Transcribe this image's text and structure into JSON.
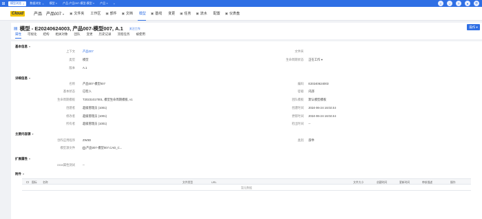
{
  "topbar": {
    "tabs": [
      {
        "label": "模型浏览",
        "active": true
      },
      {
        "label": "数据浏览",
        "active": false
      },
      {
        "label": "模型 ×",
        "active": false
      },
      {
        "label": "产品-产品007-模型-模型 ×",
        "active": false
      },
      {
        "label": "产品 ×",
        "active": false
      },
      {
        "label": "+",
        "active": false
      }
    ],
    "right_icons": [
      "search-icon",
      "bell-icon",
      "help-icon",
      "user-icon",
      "settings-icon"
    ]
  },
  "header": {
    "logo_text": "Cloud",
    "context_label": "产品",
    "context_value": "产品007",
    "nav": [
      {
        "icon": "▣",
        "label": "文件夹",
        "active": false
      },
      {
        "icon": "",
        "label": "工作区",
        "active": false
      },
      {
        "icon": "▣",
        "label": "部件",
        "active": false
      },
      {
        "icon": "▣",
        "label": "文档",
        "active": false
      },
      {
        "icon": "",
        "label": "模型",
        "active": true
      },
      {
        "icon": "▣",
        "label": "基线",
        "active": false
      },
      {
        "icon": "",
        "label": "变更",
        "active": false
      },
      {
        "icon": "▣",
        "label": "任务",
        "active": false
      },
      {
        "icon": "▣",
        "label": "流水",
        "active": false
      },
      {
        "icon": "",
        "label": "配置",
        "active": false
      },
      {
        "icon": "▣",
        "label": "仪表盘",
        "active": false
      }
    ]
  },
  "title": {
    "text": "模型 - E20240624003, 产品007-模型007, A.1",
    "follow": "关注工作",
    "ops_button": "操作 ▾",
    "subtabs": [
      {
        "label": "属性",
        "active": true
      },
      {
        "label": "可视化",
        "active": false
      },
      {
        "label": "结构",
        "active": false
      },
      {
        "label": "相关对象",
        "active": false
      },
      {
        "label": "团队",
        "active": false
      },
      {
        "label": "变更",
        "active": false
      },
      {
        "label": "历史记录",
        "active": false
      },
      {
        "label": "流程任务",
        "active": false
      },
      {
        "label": "被使用",
        "active": false
      }
    ]
  },
  "basic": {
    "title": "基本信息",
    "context_label": "上下文",
    "context_value": "产品007",
    "type_label": "类型",
    "type_value": "模型",
    "version_label": "版本",
    "version_value": "A.1",
    "folder_label": "文件夹",
    "folder_value": "",
    "lifecycle_label": "生命周期状态",
    "lifecycle_value": "正在工作 ▾"
  },
  "detail": {
    "title": "详细信息",
    "left": [
      {
        "label": "名称",
        "value": "产品007-模型007"
      },
      {
        "label": "基本状态",
        "value": "已检入"
      },
      {
        "label": "生命周期模板",
        "value": "T20231017001, 模型生命周期模板, v1"
      },
      {
        "label": "创建者",
        "value": "超级管理员 (1001)"
      },
      {
        "label": "修改者",
        "value": "超级管理员 (1001)"
      },
      {
        "label": "所有者",
        "value": "超级管理员 (1001)"
      }
    ],
    "right": [
      {
        "label": "编码",
        "value": "E20240624003"
      },
      {
        "label": "密级",
        "value": "内部"
      },
      {
        "label": "团队模板",
        "value": "默认模型模板"
      },
      {
        "label": "创建时间",
        "value": "2024-06-24 16:02:44"
      },
      {
        "label": "更新时间",
        "value": "2024-06-24 16:02:44"
      },
      {
        "label": "检出时间",
        "value": "--"
      }
    ]
  },
  "content_section": {
    "title": "主要内容源",
    "app_label": "创作应用程序",
    "app_value": "ZW3D",
    "category_label": "类别",
    "category_value": "部件",
    "file_label": "模型源文件",
    "file_value": "产品007-模型007.CAD_C..."
  },
  "extended": {
    "title": "扩展属性",
    "label": "cnas属性测试",
    "value": "--"
  },
  "attachments": {
    "title": "附件",
    "columns": [
      "图标",
      "名称",
      "文件类型",
      "URL",
      "文件大小",
      "创建时间",
      "更新时间",
      "审核描述",
      "操作"
    ],
    "empty_text": "暂无数据"
  }
}
